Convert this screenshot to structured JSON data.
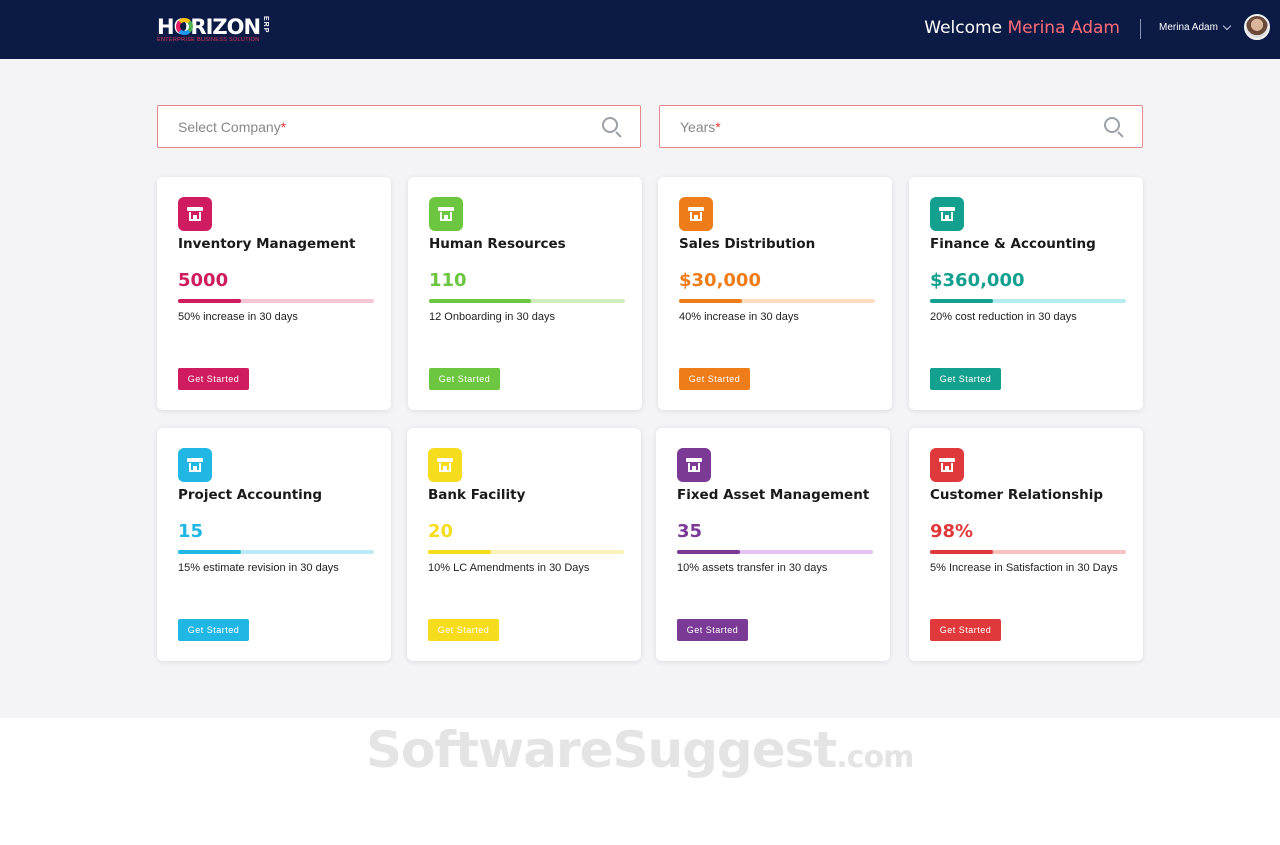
{
  "header": {
    "logo_text": "HORIZON",
    "logo_erp": "ERP",
    "logo_tagline": "ENTERPRISE BUSINESS SOLUTION",
    "welcome_prefix": "Welcome",
    "welcome_name": "Merina Adam",
    "user_name": "Merina Adam"
  },
  "filters": {
    "company": {
      "placeholder": "Select Company",
      "required_mark": "*"
    },
    "years": {
      "placeholder": "Years",
      "required_mark": "*"
    }
  },
  "cards": [
    {
      "title": "Inventory Management",
      "value": "5000",
      "progress": 0.32,
      "desc": "50% increase in 30 days",
      "button": "Get Started",
      "color": "#cf1b5f",
      "track": "#f7c6d5"
    },
    {
      "title": "Human Resources",
      "value": "110",
      "progress": 0.52,
      "desc": "12 Onboarding in 30 days",
      "button": "Get Started",
      "color": "#6cc63f",
      "track": "#cfeebd"
    },
    {
      "title": "Sales Distribution",
      "value": "$30,000",
      "progress": 0.32,
      "desc": "40% increase in 30 days",
      "button": "Get Started",
      "color": "#ee7d19",
      "track": "#fbdcbf"
    },
    {
      "title": "Finance & Accounting",
      "value": "$360,000",
      "progress": 0.32,
      "desc": "20% cost reduction in 30 days",
      "button": "Get Started",
      "color": "#14a08e",
      "track": "#b7ecef"
    },
    {
      "title": "Project Accounting",
      "value": "15",
      "progress": 0.32,
      "desc": "15% estimate revision in 30 days",
      "button": "Get Started",
      "color": "#21b7e4",
      "track": "#bdeaf6"
    },
    {
      "title": "Bank Facility",
      "value": "20",
      "progress": 0.32,
      "desc": "10% LC Amendments in 30 Days",
      "button": "Get Started",
      "color": "#f5dc1c",
      "track": "#fcf1b8"
    },
    {
      "title": "Fixed Asset Management",
      "value": "35",
      "progress": 0.32,
      "desc": "10% assets transfer in 30 days",
      "button": "Get Started",
      "color": "#7b3a96",
      "track": "#e6c4ef"
    },
    {
      "title": "Customer Relationship",
      "value": "98%",
      "progress": 0.32,
      "desc": "5% Increase in Satisfaction in 30 Days",
      "button": "Get Started",
      "color": "#e0393b",
      "track": "#f6c2c0"
    }
  ],
  "watermark": {
    "main": "SoftwareSuggest",
    "suffix": ".com"
  }
}
